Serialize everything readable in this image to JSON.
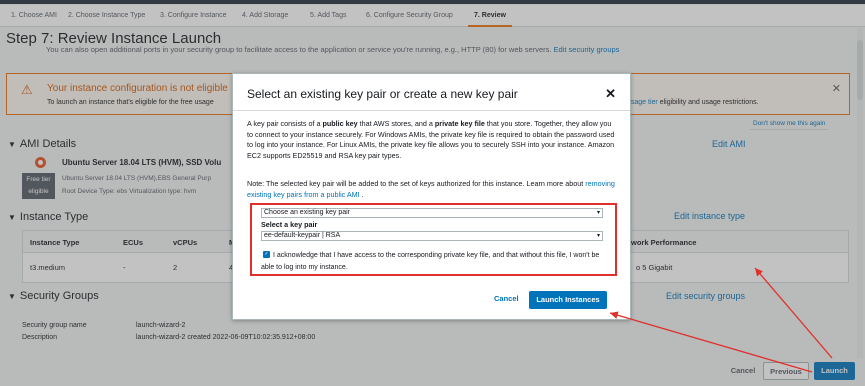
{
  "wizard_steps": [
    {
      "label": "1. Choose AMI"
    },
    {
      "label": "2. Choose Instance Type"
    },
    {
      "label": "3. Configure Instance"
    },
    {
      "label": "4. Add Storage"
    },
    {
      "label": "5. Add Tags"
    },
    {
      "label": "6. Configure Security Group"
    },
    {
      "label": "7. Review"
    }
  ],
  "page": {
    "title": "Step 7: Review Instance Launch",
    "sg_note": "You can also open additional ports in your security group to facilitate access to the application or service you're running, e.g., HTTP (80) for web servers.",
    "sg_note_link": "Edit security groups"
  },
  "warning": {
    "title": "Your instance configuration is not eligible",
    "sub": "To launch an instance that's eligible for the free usage",
    "link": "usage tier",
    "sub_right": "eligibility and usage restrictions.",
    "dont_show": "Don't show me this again"
  },
  "ami": {
    "heading": "AMI Details",
    "edit": "Edit AMI",
    "name": "Ubuntu Server 18.04 LTS (HVM), SSD Volu",
    "free_tier_1": "Free tier",
    "free_tier_2": "eligible",
    "desc": "Ubuntu Server 18.04 LTS (HVM),EBS General Purp",
    "meta": "Root Device Type: ebs    Virtualization type: hvm"
  },
  "instance_type": {
    "heading": "Instance Type",
    "edit": "Edit instance type",
    "columns": [
      "Instance Type",
      "ECUs",
      "vCPUs",
      "M"
    ],
    "col_right": "work Performance",
    "row": [
      "t3.medium",
      "-",
      "2",
      "4"
    ],
    "row_right": "o 5 Gigabit"
  },
  "security_groups": {
    "heading": "Security Groups",
    "edit": "Edit security groups",
    "rows": [
      {
        "label": "Security group name",
        "value": "launch-wizard-2"
      },
      {
        "label": "Description",
        "value": "launch-wizard-2 created 2022-06-09T10:02:35.912+08:00"
      }
    ]
  },
  "footer": {
    "cancel": "Cancel",
    "previous": "Previous",
    "launch": "Launch"
  },
  "modal": {
    "title": "Select an existing key pair or create a new key pair",
    "close": "✕",
    "p1_a": "A key pair consists of a ",
    "p1_b": "public key",
    "p1_c": " that AWS stores, and a ",
    "p1_d": "private key file",
    "p1_e": " that you store. Together, they allow you to connect to your instance securely. For Windows AMIs, the private key file is required to obtain the password used to log into your instance. For Linux AMIs, the private key file allows you to securely SSH into your instance. Amazon EC2 supports ED25519 and RSA key pair types.",
    "p2_a": "Note: The selected key pair will be added to the set of keys authorized for this instance. Learn more about ",
    "p2_link": "removing existing key pairs from a public AMI",
    "p2_b": " .",
    "select_mode": "Choose an existing key pair",
    "select_label": "Select a key pair",
    "select_key": "ee-default-keypair | RSA",
    "ack": "I acknowledge that I have access to the corresponding private key file, and that without this file, I won't be able to log into my instance.",
    "cancel": "Cancel",
    "launch": "Launch Instances"
  },
  "colors": {
    "accent": "#0073bb",
    "warning": "#ec7211",
    "annotation": "#e0302b"
  }
}
